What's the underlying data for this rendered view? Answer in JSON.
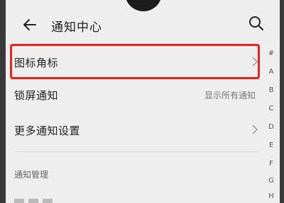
{
  "header": {
    "title": "通知中心",
    "back_icon": "back-arrow-icon",
    "search_icon": "search-icon"
  },
  "settings": [
    {
      "label": "图标角标",
      "value": "",
      "has_chevron": true,
      "highlighted": true
    },
    {
      "label": "锁屏通知",
      "value": "显示所有通知",
      "has_chevron": false
    },
    {
      "label": "更多通知设置",
      "value": "",
      "has_chevron": true
    }
  ],
  "section": {
    "title": "通知管理"
  },
  "alpha_index": [
    "#",
    "A",
    "B",
    "C",
    "D",
    "E",
    "F",
    "G",
    "H"
  ],
  "colors": {
    "highlight": "#e8231d",
    "background": "#eeeeee",
    "text": "#222222"
  }
}
